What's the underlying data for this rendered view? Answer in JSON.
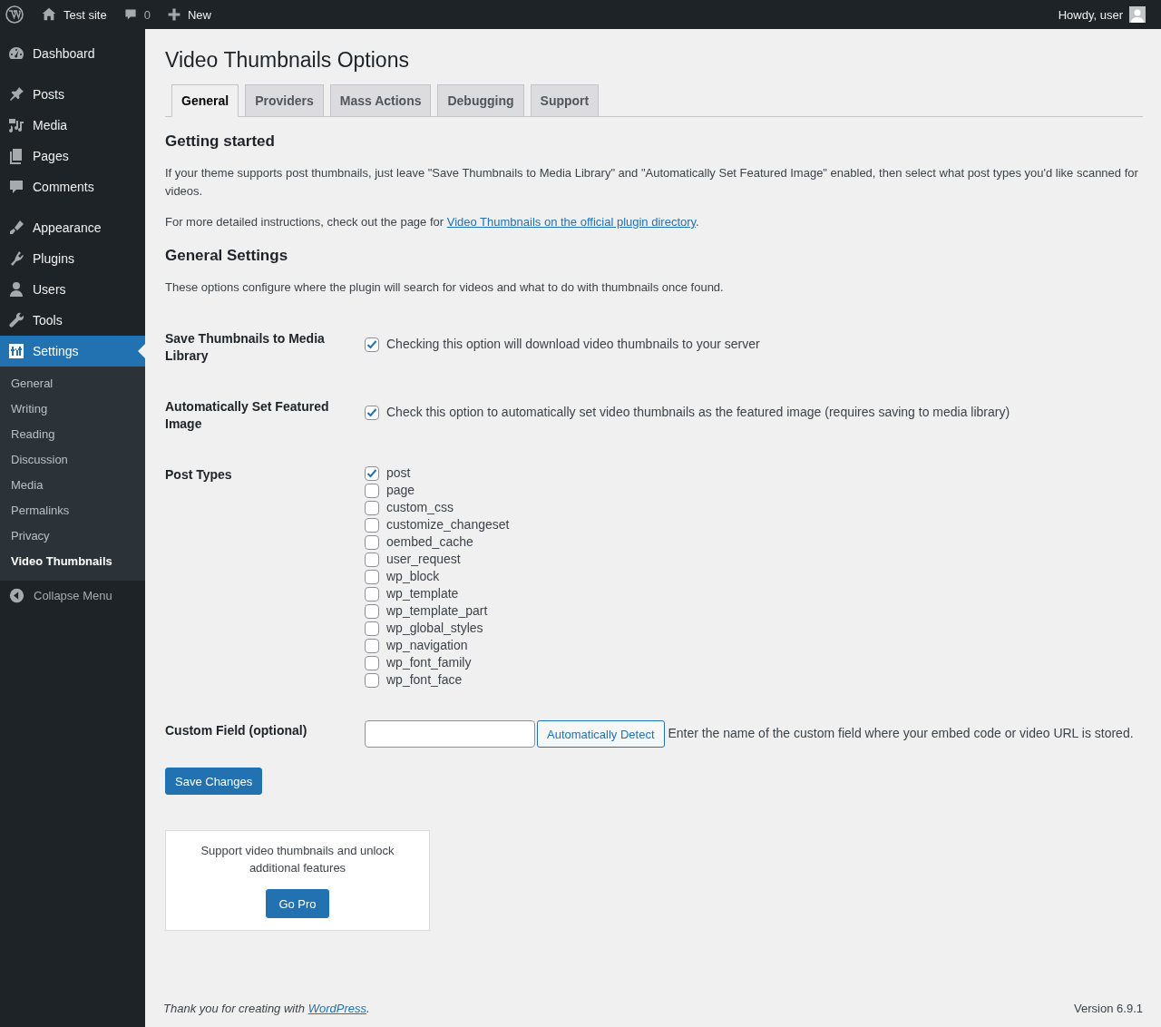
{
  "admin_bar": {
    "site_name": "Test site",
    "comments_count": "0",
    "new_label": "New",
    "greeting": "Howdy, user"
  },
  "sidebar": {
    "groups": [
      [
        {
          "label": "Dashboard",
          "selected": false
        }
      ],
      [
        {
          "label": "Posts",
          "selected": false
        },
        {
          "label": "Media",
          "selected": false
        },
        {
          "label": "Pages",
          "selected": false
        },
        {
          "label": "Comments",
          "selected": false
        }
      ],
      [
        {
          "label": "Appearance",
          "selected": false
        },
        {
          "label": "Plugins",
          "selected": false
        },
        {
          "label": "Users",
          "selected": false
        },
        {
          "label": "Tools",
          "selected": false
        },
        {
          "label": "Settings",
          "selected": true
        }
      ]
    ],
    "submenu": [
      {
        "label": "General",
        "selected": false
      },
      {
        "label": "Writing",
        "selected": false
      },
      {
        "label": "Reading",
        "selected": false
      },
      {
        "label": "Discussion",
        "selected": false
      },
      {
        "label": "Media",
        "selected": false
      },
      {
        "label": "Permalinks",
        "selected": false
      },
      {
        "label": "Privacy",
        "selected": false
      },
      {
        "label": "Video Thumbnails",
        "selected": true
      }
    ],
    "collapse_label": "Collapse Menu"
  },
  "page_title": "Video Thumbnails Options",
  "tabs": [
    {
      "label": "General",
      "selected": true
    },
    {
      "label": "Providers",
      "selected": false
    },
    {
      "label": "Mass Actions",
      "selected": false
    },
    {
      "label": "Debugging",
      "selected": false
    },
    {
      "label": "Support",
      "selected": false
    }
  ],
  "getting_started": {
    "heading": "Getting started",
    "paragraph": "If your theme supports post thumbnails, just leave \"Save Thumbnails to Media Library\" and \"Automatically Set Featured Image\" enabled, then select what post types you'd like scanned for videos.",
    "instructions": {
      "before": "For more detailed instructions, check out the page for ",
      "link": "Video Thumbnails on the official plugin directory",
      "after": "."
    }
  },
  "general_settings": {
    "heading": "General Settings",
    "description": "These options configure where the plugin will search for videos and what to do with thumbnails once found.",
    "rows": [
      {
        "kind": "checkbox",
        "label": "Save Thumbnails to Media Library",
        "checked": true,
        "description": "Checking this option will download video thumbnails to your server"
      },
      {
        "kind": "checkbox",
        "label": "Automatically Set Featured Image",
        "checked": true,
        "description": "Check this option to automatically set video thumbnails as the featured image (requires saving to media library)"
      },
      {
        "kind": "checklist",
        "label": "Post Types",
        "options": [
          {
            "label": "post",
            "checked": true
          },
          {
            "label": "page",
            "checked": false
          },
          {
            "label": "custom_css",
            "checked": false
          },
          {
            "label": "customize_changeset",
            "checked": false
          },
          {
            "label": "oembed_cache",
            "checked": false
          },
          {
            "label": "user_request",
            "checked": false
          },
          {
            "label": "wp_block",
            "checked": false
          },
          {
            "label": "wp_template",
            "checked": false
          },
          {
            "label": "wp_template_part",
            "checked": false
          },
          {
            "label": "wp_global_styles",
            "checked": false
          },
          {
            "label": "wp_navigation",
            "checked": false
          },
          {
            "label": "wp_font_family",
            "checked": false
          },
          {
            "label": "wp_font_face",
            "checked": false
          }
        ]
      },
      {
        "kind": "custom_field",
        "label": "Custom Field (optional)",
        "button": "Automatically Detect",
        "description": "Enter the name of the custom field where your embed code or video URL is stored."
      }
    ]
  },
  "save_button": "Save Changes",
  "promo": {
    "text": "Support video thumbnails and unlock additional features",
    "button": "Go Pro"
  },
  "footer": {
    "before": "Thank you for creating with ",
    "link": "WordPress",
    "after": ".",
    "version": "Version 6.9.1"
  }
}
